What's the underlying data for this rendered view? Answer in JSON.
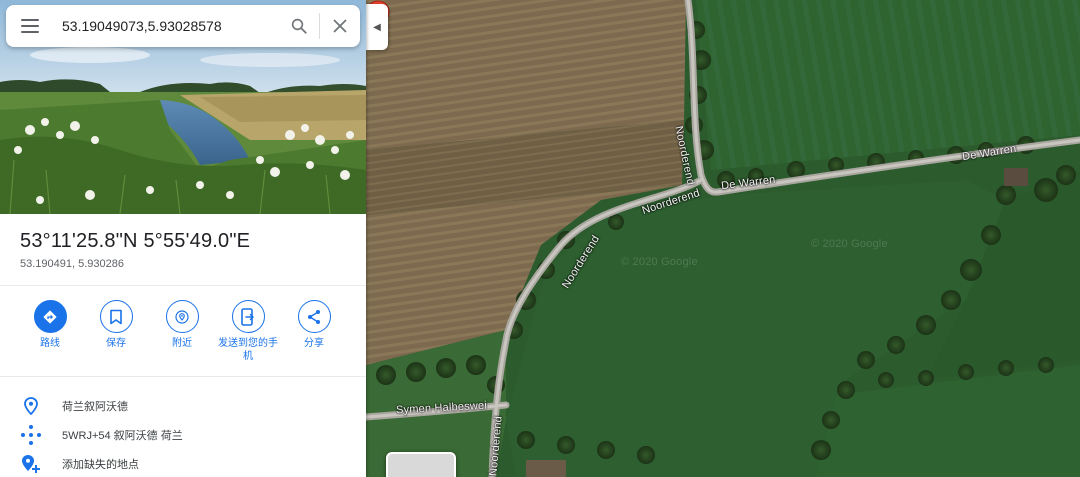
{
  "search": {
    "value": "53.19049073,5.93028578"
  },
  "place": {
    "title": "53°11'25.8\"N 5°55'49.0\"E",
    "decimal": "53.190491, 5.930286"
  },
  "actions": [
    {
      "label": "路线",
      "icon": "directions-icon"
    },
    {
      "label": "保存",
      "icon": "bookmark-icon"
    },
    {
      "label": "附近",
      "icon": "nearby-icon"
    },
    {
      "label": "发送到您的手机",
      "icon": "send-to-phone-icon"
    },
    {
      "label": "分享",
      "icon": "share-icon"
    }
  ],
  "info": [
    {
      "text": "荷兰叙阿沃德",
      "icon": "location-pin-icon"
    },
    {
      "text": "5WRJ+54 叙阿沃德 荷兰",
      "icon": "plus-code-icon"
    },
    {
      "text": "添加缺失的地点",
      "icon": "add-place-icon"
    }
  ],
  "map": {
    "labels": {
      "noorderend_north": "Noorderend",
      "noorderend_mid": "Noorderend",
      "noorderend_curve": "Noorderend",
      "noorderend_south": "Noorderend",
      "de_warren_1": "De Warren",
      "de_warren_2": "De Warren",
      "symen": "Symen Halbeswei"
    },
    "watermarks": [
      "© 2020 Google",
      "© 2020 Google"
    ]
  },
  "colors": {
    "accent": "#1a73e8",
    "pin": "#ea4335"
  }
}
